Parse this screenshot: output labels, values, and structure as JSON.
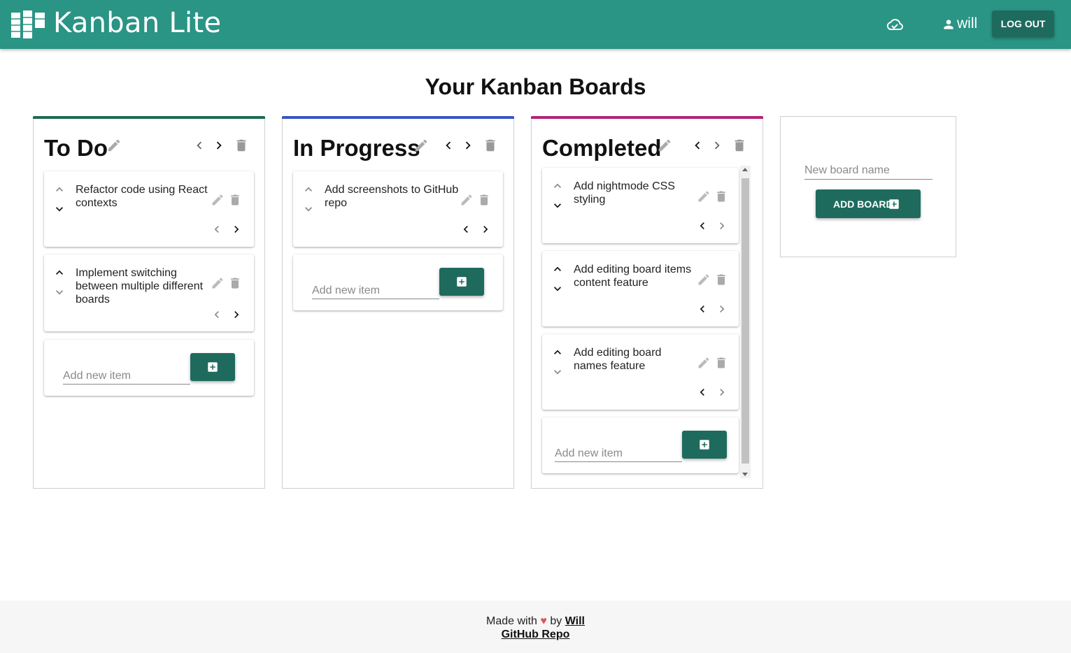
{
  "header": {
    "app_title": "Kanban Lite",
    "username": "will",
    "logout_label": "LOG OUT",
    "color": "#2a9485"
  },
  "page_title": "Your Kanban Boards",
  "boards": [
    {
      "name": "To Do",
      "accent": "#1f6b55",
      "items": [
        {
          "text": "Refactor code using React contexts"
        },
        {
          "text": "Implement switching between multiple different boards"
        }
      ],
      "add_placeholder": "Add new item"
    },
    {
      "name": "In Progress",
      "accent": "#3b55c4",
      "items": [
        {
          "text": "Add screenshots to GitHub repo"
        }
      ],
      "add_placeholder": "Add new item"
    },
    {
      "name": "Completed",
      "accent": "#b3237d",
      "items": [
        {
          "text": "Add nightmode CSS styling"
        },
        {
          "text": "Add editing board items content feature"
        },
        {
          "text": "Add editing board names feature"
        }
      ],
      "add_placeholder": "Add new item"
    }
  ],
  "new_board": {
    "placeholder": "New board name",
    "button_label": "ADD BOARD"
  },
  "footer": {
    "made_with": "Made with",
    "heart": "♥",
    "by": "by",
    "author": "Will",
    "repo_link": "GitHub Repo"
  },
  "button_color": "#1e6b5e"
}
